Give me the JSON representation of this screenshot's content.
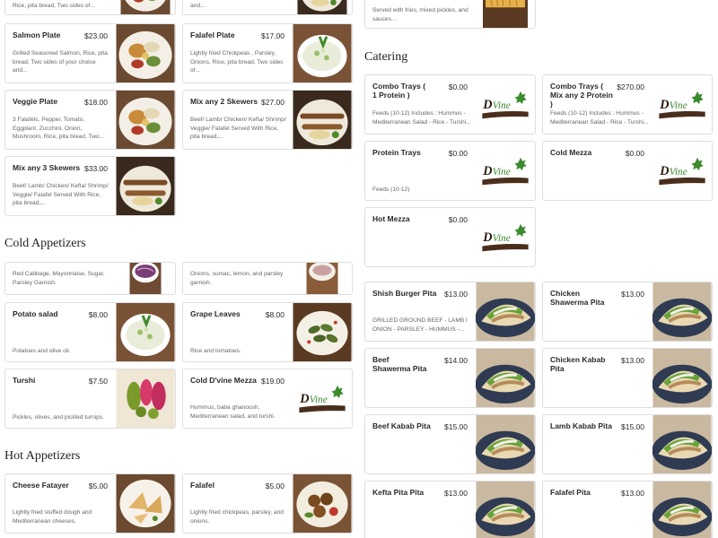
{
  "sections": {
    "catering": "Catering",
    "cold_appetizers": "Cold Appetizers",
    "hot_appetizers": "Hot Appetizers"
  },
  "top_partial": {
    "left_desc": "Rice, pita bread, Two sides of...",
    "mid_desc": "and...",
    "right_desc_line1": "Served with fries, mixed pickles, and",
    "right_desc_line2": "sauces..."
  },
  "plates": [
    {
      "name": "Salmon Plate",
      "price": "$23.00",
      "desc": "Grilled Seasoned Salmon, Rice, pita bread, Two sides of your choice and...",
      "image": "salmon-plate-photo"
    },
    {
      "name": "Falafel Plate",
      "price": "$17.00",
      "desc": "Lightly fried Chickpeas , Parsley, Onions, Rice, pita bread, Two sides of...",
      "image": "falafel-plate-photo"
    },
    {
      "name": "Veggie Plate",
      "price": "$18.00",
      "desc": "3 Falafels, Pepper, Tomato, Eggplant, Zucchini, Onion, Mushroom, Rice, pita bread, Two...",
      "image": "veggie-plate-photo"
    },
    {
      "name": "Mix any 2 Skewers",
      "price": "$27.00",
      "desc": "Beef/ Lamb/ Chicken/ Kefta/ Shrimp/ Veggie/ Falafel Served With Rice, pita bread,...",
      "image": "skewers-photo"
    },
    {
      "name": "Mix any 3 Skewers",
      "price": "$33.00",
      "desc": "Beef/ Lamb/ Chicken/ Kefta/ Shrimp/ Veggie/ Falafel Served With Rice, pita bread,...",
      "image": "skewers-3-photo"
    }
  ],
  "cold_partial": {
    "left_desc": "Red Cabbage, Mayonnaise, Sugar, Parsley Garnish.",
    "right_desc": "Onions, sumac, lemon, and parsley garnish."
  },
  "cold_items": [
    {
      "name": "Potato salad",
      "price": "$8.00",
      "desc": "Potatoes and olive oil.",
      "image": "potato-salad-photo"
    },
    {
      "name": "Grape Leaves",
      "price": "$8.00",
      "desc": "Rice and tomatoes.",
      "image": "grape-leaves-photo"
    },
    {
      "name": "Turshi",
      "price": "$7.50",
      "desc": "Pickles, olives, and pickled turnips.",
      "image": "turshi-photo"
    },
    {
      "name": "Cold D'vine Mezza",
      "price": "$19.00",
      "desc": "Hummus, baba ghanoush, Mediterranean salad, and turshi.",
      "image": "dvine-logo"
    }
  ],
  "hot_items": [
    {
      "name": "Cheese Fatayer",
      "price": "$5.00",
      "desc": "Lightly fried stuffed dough and Mediterranean cheeses.",
      "image": "fatayer-photo"
    },
    {
      "name": "Falafel",
      "price": "$5.00",
      "desc": "Lightly fried chickpeas, parsley, and onions.",
      "image": "falafel-photo"
    }
  ],
  "catering_items": [
    {
      "name": "Combo Trays ( 1 Protein )",
      "price": "$0.00",
      "desc": "Feeds (10-12) Includes : Hummus - Mediterranean Salad - Rice - Turshi...",
      "image": "dvine-logo"
    },
    {
      "name": "Combo Trays ( Mix any 2 Protein )",
      "price": "$270.00",
      "desc": "Feeds (10-12) Includes : Hummus - Mediterranean Salad - Rice - Turshi...",
      "image": "dvine-logo"
    },
    {
      "name": "Protein Trays",
      "price": "$0.00",
      "desc": "Feeds (10-12)",
      "image": "dvine-logo"
    },
    {
      "name": "Cold Mezza",
      "price": "$0.00",
      "desc": "",
      "image": "dvine-logo"
    },
    {
      "name": "Hot Mezza",
      "price": "$0.00",
      "desc": "",
      "image": "dvine-logo"
    }
  ],
  "pitas": [
    {
      "name": "Shish Burger Pita",
      "price": "$13.00",
      "desc": "GRILLED GROUND BEEF - LAMB I ONION - PARSLEY - HUMMUS -...",
      "image": "pita-photo"
    },
    {
      "name": "Chicken Shawerma Pita",
      "price": "$13.00",
      "desc": "",
      "image": "pita-photo"
    },
    {
      "name": "Beef Shawerma Pita",
      "price": "$14.00",
      "desc": "",
      "image": "pita-photo"
    },
    {
      "name": "Chicken Kabab Pita",
      "price": "$13.00",
      "desc": "",
      "image": "pita-photo"
    },
    {
      "name": "Beef Kabab Pita",
      "price": "$15.00",
      "desc": "",
      "image": "pita-photo"
    },
    {
      "name": "Lamb Kabab Pita",
      "price": "$15.00",
      "desc": "",
      "image": "pita-photo"
    },
    {
      "name": "Kefta Pita Pita",
      "price": "$13.00",
      "desc": "",
      "image": "pita-photo"
    },
    {
      "name": "Falafel Pita",
      "price": "$13.00",
      "desc": "",
      "image": "pita-photo"
    }
  ],
  "logo": {
    "text": "D'Vine"
  },
  "colors": {
    "accent_green": "#3b8a2e",
    "logo_brown": "#4a2e1c",
    "border": "#dedede"
  }
}
